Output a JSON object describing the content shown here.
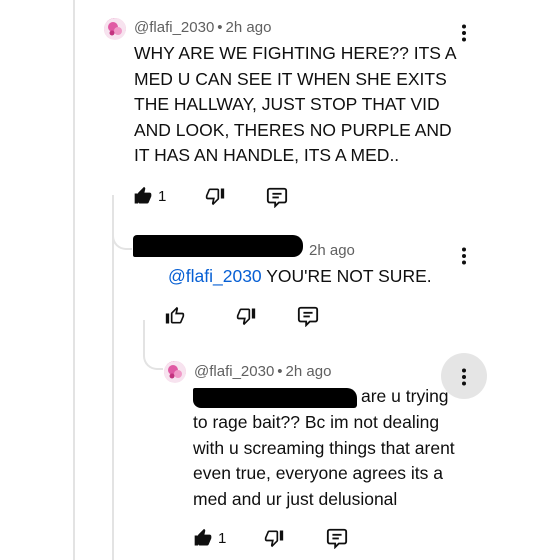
{
  "comment1": {
    "handle": "@flafi_2030",
    "time": "2h ago",
    "body": "WHY ARE WE FIGHTING HERE?? ITS A MED U CAN SEE IT WHEN SHE EXITS THE HALLWAY, JUST STOP THAT VID AND LOOK, THERES NO PURPLE AND IT HAS AN HANDLE, ITS A MED..",
    "like_count": "1"
  },
  "reply1": {
    "time": "2h ago",
    "mention": "@flafi_2030",
    "body": " YOU'RE NOT SURE."
  },
  "reply2": {
    "handle": "@flafi_2030",
    "time": "2h ago",
    "body_first": "are u trying",
    "body_rest": "to rage bait?? Bc im not dealing with u screaming things that arent even true, everyone agrees its a med and ur just delusional",
    "like_count": "1"
  },
  "icons": {
    "like_filled": "thumb-up-filled-icon",
    "like": "thumb-up-icon",
    "dislike": "thumb-down-icon",
    "reply": "comment-reply-icon",
    "more": "more-vert-icon"
  },
  "colors": {
    "mention": "#065fd4",
    "meta": "#606060",
    "thread": "#e3e3e3"
  }
}
